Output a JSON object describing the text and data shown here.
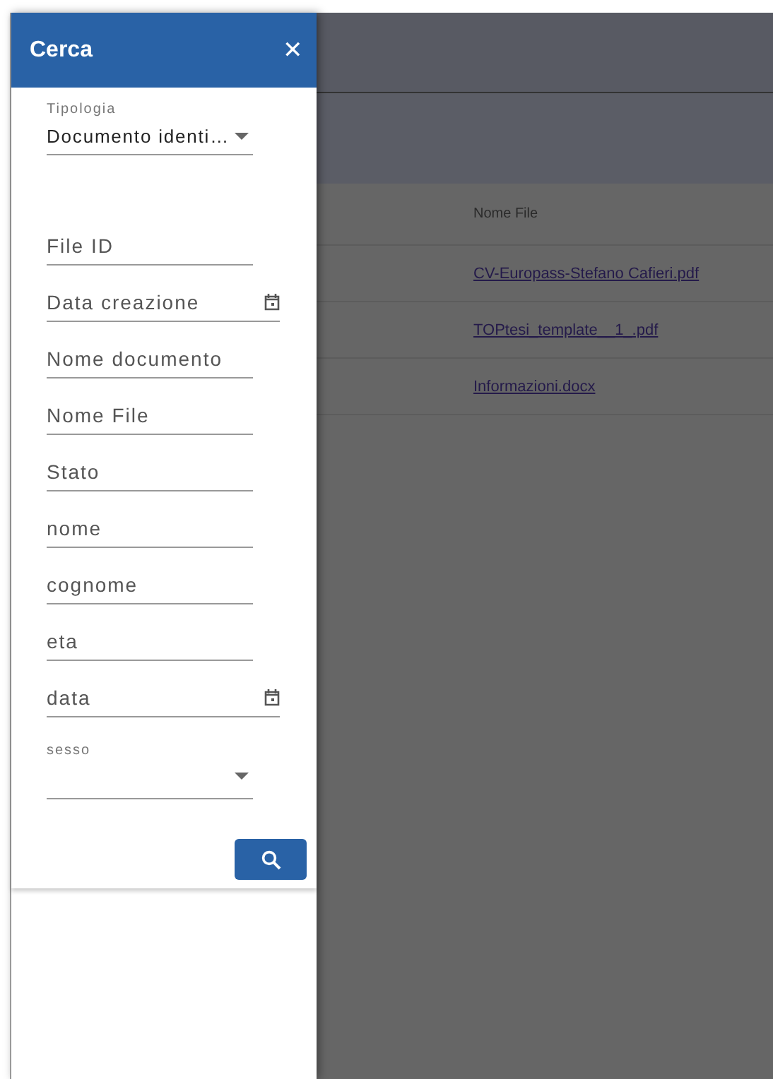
{
  "search_panel": {
    "title": "Cerca",
    "close_icon": "✕",
    "fields": [
      {
        "kind": "select",
        "label": "Tipologia",
        "value": "Documento identi…"
      },
      {
        "kind": "text",
        "placeholder": "File ID"
      },
      {
        "kind": "date",
        "placeholder": "Data creazione"
      },
      {
        "kind": "text",
        "placeholder": "Nome documento"
      },
      {
        "kind": "text",
        "placeholder": "Nome File"
      },
      {
        "kind": "text",
        "placeholder": "Stato"
      },
      {
        "kind": "text",
        "placeholder": "nome"
      },
      {
        "kind": "text",
        "placeholder": "cognome"
      },
      {
        "kind": "text",
        "placeholder": "eta"
      },
      {
        "kind": "date",
        "placeholder": "data"
      },
      {
        "kind": "select",
        "label": "sesso"
      }
    ]
  },
  "table": {
    "columns": [
      "Nome File"
    ],
    "rows": [
      {
        "file": "CV-Europass-Stefano Cafieri.pdf"
      },
      {
        "file": "TOPtesi_template__1_.pdf"
      },
      {
        "file": "Informazioni.docx"
      }
    ]
  }
}
